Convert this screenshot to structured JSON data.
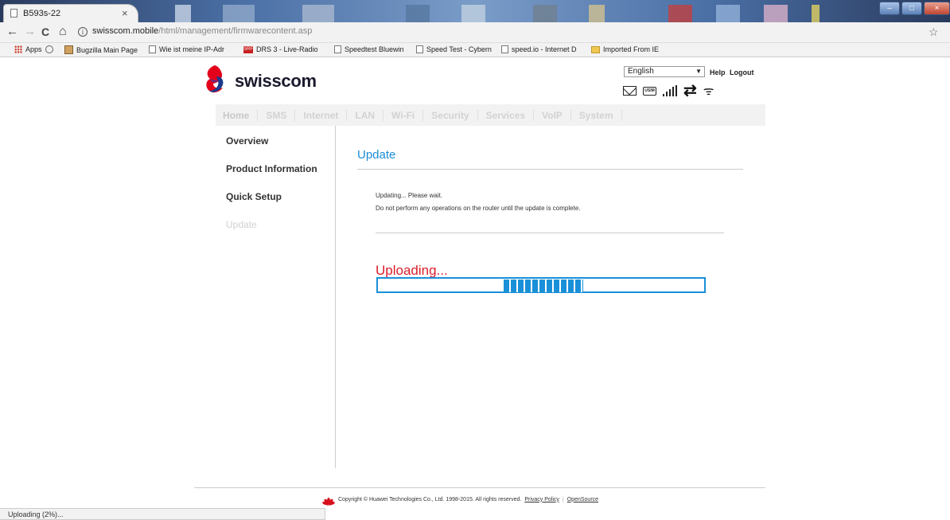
{
  "browser": {
    "tab_title": "B593s-22",
    "tab_close": "×",
    "url_domain": "swisscom.mobile",
    "url_path": "/html/management/firmwarecontent.asp",
    "nav": {
      "back": "←",
      "forward": "→",
      "reload": "C",
      "home": "⌂",
      "info": "i",
      "star": "☆"
    },
    "window_buttons": {
      "minimize": "–",
      "maximize": "□",
      "close": "×"
    },
    "bookmarks": [
      "Apps",
      "Bugzilla Main Page",
      "Wie ist meine IP-Adr",
      "DRS 3 - Live-Radio",
      "Speedtest Bluewin",
      "Speed Test - Cybern",
      "speed.io - Internet D",
      "Imported From IE"
    ],
    "bookmark_srf": "SRF",
    "status_text": "Uploading (2%)..."
  },
  "header": {
    "brand": "swisscom",
    "language": "English",
    "lang_arrow": "▼",
    "help": "Help",
    "logout": "Logout",
    "sim_label": "USIM",
    "arrows": "⇄",
    "wifi": "ᯤ"
  },
  "menu": [
    "Home",
    "SMS",
    "Internet",
    "LAN",
    "Wi-Fi",
    "Security",
    "Services",
    "VoIP",
    "System"
  ],
  "sidebar": [
    "Overview",
    "Product Information",
    "Quick Setup",
    "Update"
  ],
  "content": {
    "title": "Update",
    "msg1": "Updating... Please wait.",
    "msg2": "Do not perform any operations on the router until the update is complete.",
    "uploading": "Uploading..."
  },
  "progress": {
    "value_fraction": 0.245,
    "start_fraction": 0.385
  },
  "footer": {
    "copyright": "Copyright © Huawei Technologies Co., Ltd. 1998-2015. All rights reserved.",
    "privacy": "Privacy Policy",
    "sep": "|",
    "opensource": "OpenSource"
  },
  "colors": {
    "accent": "#1a90d8",
    "uploading": "#d91f2b",
    "brand_red": "#e2001a",
    "brand_blue": "#1c3a8c"
  }
}
